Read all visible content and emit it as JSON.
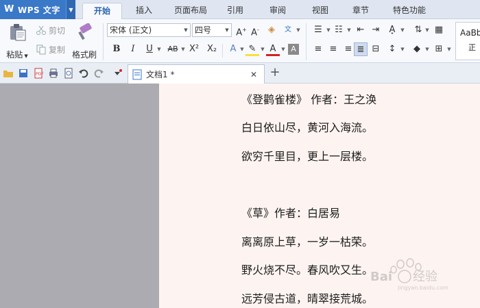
{
  "app": {
    "name": "WPS 文字",
    "logo_glyph": "W",
    "accent": "#3a78c8"
  },
  "menu": {
    "tabs": [
      {
        "label": "开始",
        "active": true
      },
      {
        "label": "插入"
      },
      {
        "label": "页面布局"
      },
      {
        "label": "引用"
      },
      {
        "label": "审阅"
      },
      {
        "label": "视图"
      },
      {
        "label": "章节"
      },
      {
        "label": "特色功能"
      }
    ]
  },
  "ribbon": {
    "paste_label": "粘贴",
    "cut_label": "剪切",
    "copy_label": "复制",
    "format_painter_label": "格式刷",
    "font_name": "宋体 (正文)",
    "font_size": "四号",
    "bold": "B",
    "italic": "I",
    "underline": "U",
    "strikethrough": "AB",
    "superscript": "X²",
    "subscript": "X₂",
    "style_preview": "AaBb",
    "style_name": "正"
  },
  "document_tab": {
    "title": "文档1 *"
  },
  "document": {
    "lines": [
      "《登鹳雀楼》  作者：王之涣",
      "白日依山尽，黄河入海流。",
      "欲穷千里目，更上一层楼。",
      "",
      "《草》作者：白居易",
      "离离原上草，一岁一枯荣。",
      "野火烧不尽。春风吹又生。",
      "远芳侵古道，晴翠接荒城。"
    ]
  },
  "watermark": {
    "text": "Bai 经验",
    "subtext": "jingyan.baidu.com"
  }
}
